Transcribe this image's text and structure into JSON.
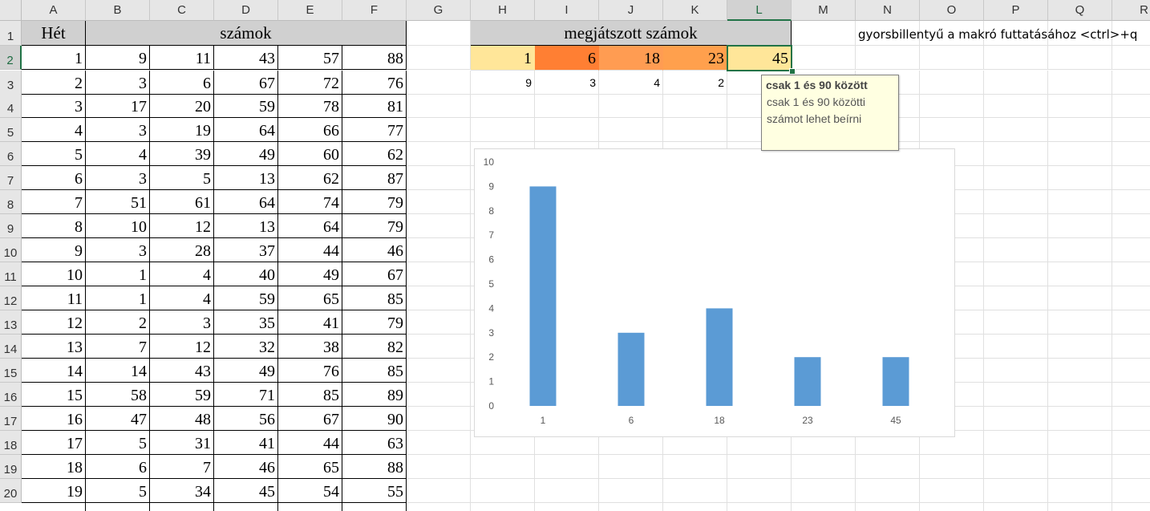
{
  "columns": [
    "A",
    "B",
    "C",
    "D",
    "E",
    "F",
    "G",
    "H",
    "I",
    "J",
    "K",
    "L",
    "M",
    "N",
    "O",
    "P",
    "Q",
    "R"
  ],
  "selected_column": "L",
  "rows": [
    "1",
    "2",
    "3",
    "4",
    "5",
    "6",
    "7",
    "8",
    "9",
    "10",
    "11",
    "12",
    "13",
    "14",
    "15",
    "16",
    "17",
    "18",
    "19",
    "20"
  ],
  "selected_row": "2",
  "table": {
    "header_het": "Hét",
    "header_szamok": "számok",
    "data": [
      [
        1,
        9,
        11,
        43,
        57,
        88
      ],
      [
        2,
        3,
        6,
        67,
        72,
        76
      ],
      [
        3,
        17,
        20,
        59,
        78,
        81
      ],
      [
        4,
        3,
        19,
        64,
        66,
        77
      ],
      [
        5,
        4,
        39,
        49,
        60,
        62
      ],
      [
        6,
        3,
        5,
        13,
        62,
        87
      ],
      [
        7,
        51,
        61,
        64,
        74,
        79
      ],
      [
        8,
        10,
        12,
        13,
        64,
        79
      ],
      [
        9,
        3,
        28,
        37,
        44,
        46
      ],
      [
        10,
        1,
        4,
        40,
        49,
        67
      ],
      [
        11,
        1,
        4,
        59,
        65,
        85
      ],
      [
        12,
        2,
        3,
        35,
        41,
        79
      ],
      [
        13,
        7,
        12,
        32,
        38,
        82
      ],
      [
        14,
        14,
        43,
        49,
        76,
        85
      ],
      [
        15,
        58,
        59,
        71,
        85,
        89
      ],
      [
        16,
        47,
        48,
        56,
        67,
        90
      ],
      [
        17,
        5,
        31,
        41,
        44,
        63
      ],
      [
        18,
        6,
        7,
        46,
        65,
        88
      ],
      [
        19,
        5,
        34,
        45,
        54,
        55
      ]
    ]
  },
  "played": {
    "header": "megjátszott számok",
    "numbers": [
      "1",
      "6",
      "18",
      "23",
      "45"
    ],
    "counts": [
      "9",
      "3",
      "4",
      "2",
      ""
    ],
    "colors": [
      "#ffe699",
      "#ff7f33",
      "#ff9c52",
      "#ffa04d",
      "#ffe699"
    ]
  },
  "macro_note": "gyorsbillentyű a makró futtatásához <ctrl>+q",
  "tooltip": {
    "title": "csak 1 és 90 között",
    "line1": "csak 1 és 90 közötti",
    "line2": "számot lehet beírni"
  },
  "chart_data": {
    "type": "bar",
    "categories": [
      "1",
      "6",
      "18",
      "23",
      "45"
    ],
    "values": [
      9,
      3,
      4,
      2,
      2
    ],
    "title": "",
    "xlabel": "",
    "ylabel": "",
    "ylim": [
      0,
      10
    ],
    "yticks": [
      "0",
      "1",
      "2",
      "3",
      "4",
      "5",
      "6",
      "7",
      "8",
      "9",
      "10"
    ],
    "grid": false,
    "bar_color": "#5b9bd5"
  }
}
